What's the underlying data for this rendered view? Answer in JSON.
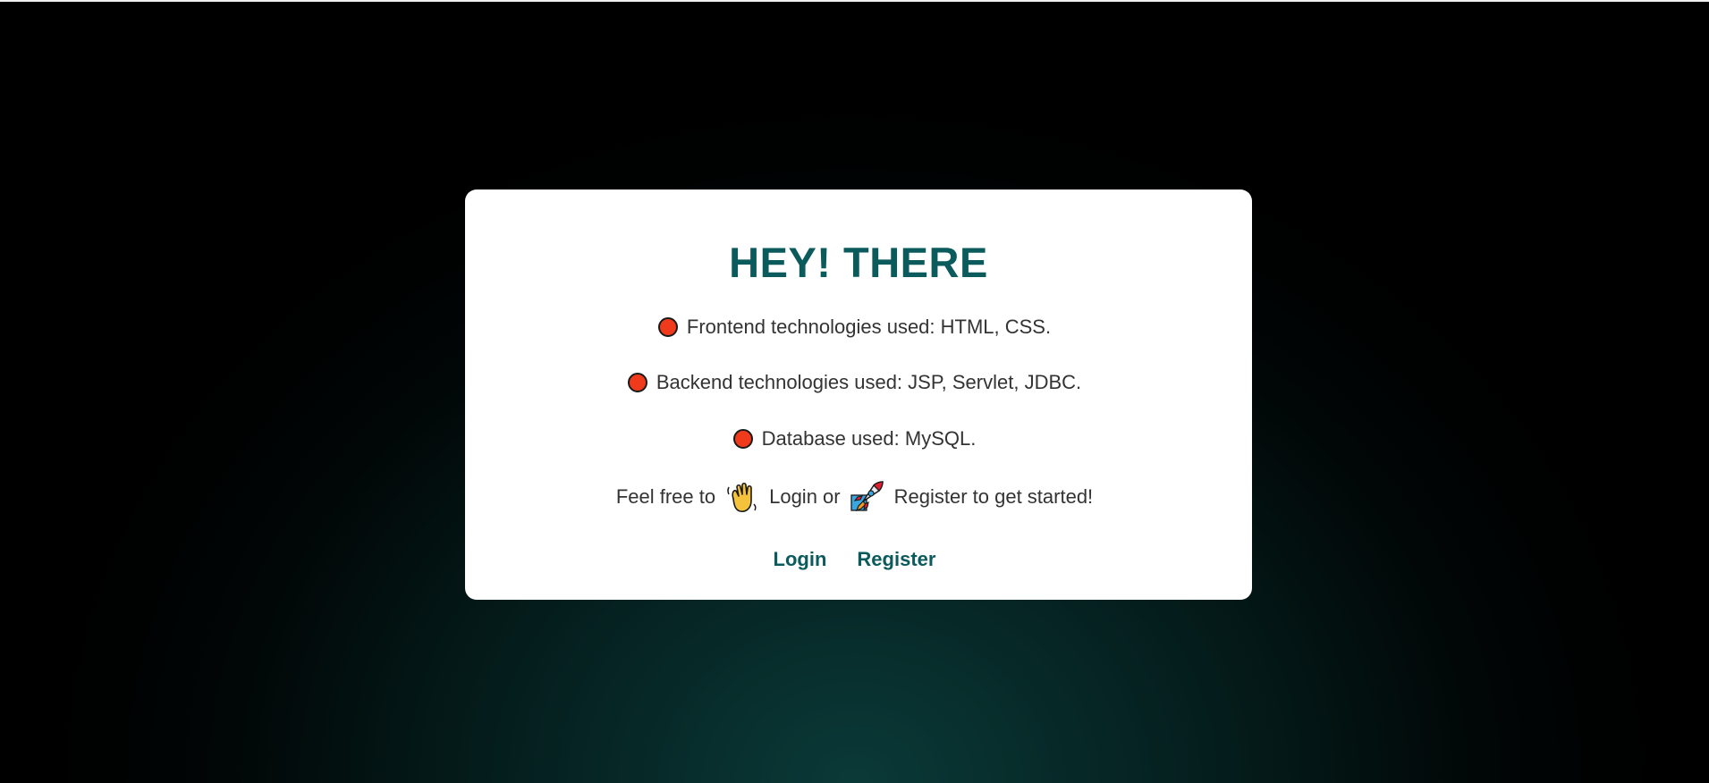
{
  "card": {
    "title": "HEY! THERE",
    "features": [
      "Frontend technologies used: HTML, CSS.",
      "Backend technologies used: JSP, Servlet, JDBC.",
      "Database used: MySQL."
    ],
    "cta": {
      "prefix": "Feel free to",
      "login_text": "Login or",
      "register_text": "Register to get started!",
      "wave_icon": "waving-hand-icon",
      "rocket_icon": "rocket-icon"
    },
    "links": {
      "login": "Login",
      "register": "Register"
    }
  },
  "colors": {
    "accent": "#0b5a5c",
    "bullet": "#ef3a1c",
    "text": "#333333",
    "card_bg": "#ffffff"
  },
  "icons": {
    "bullet": "red-circle-icon"
  }
}
